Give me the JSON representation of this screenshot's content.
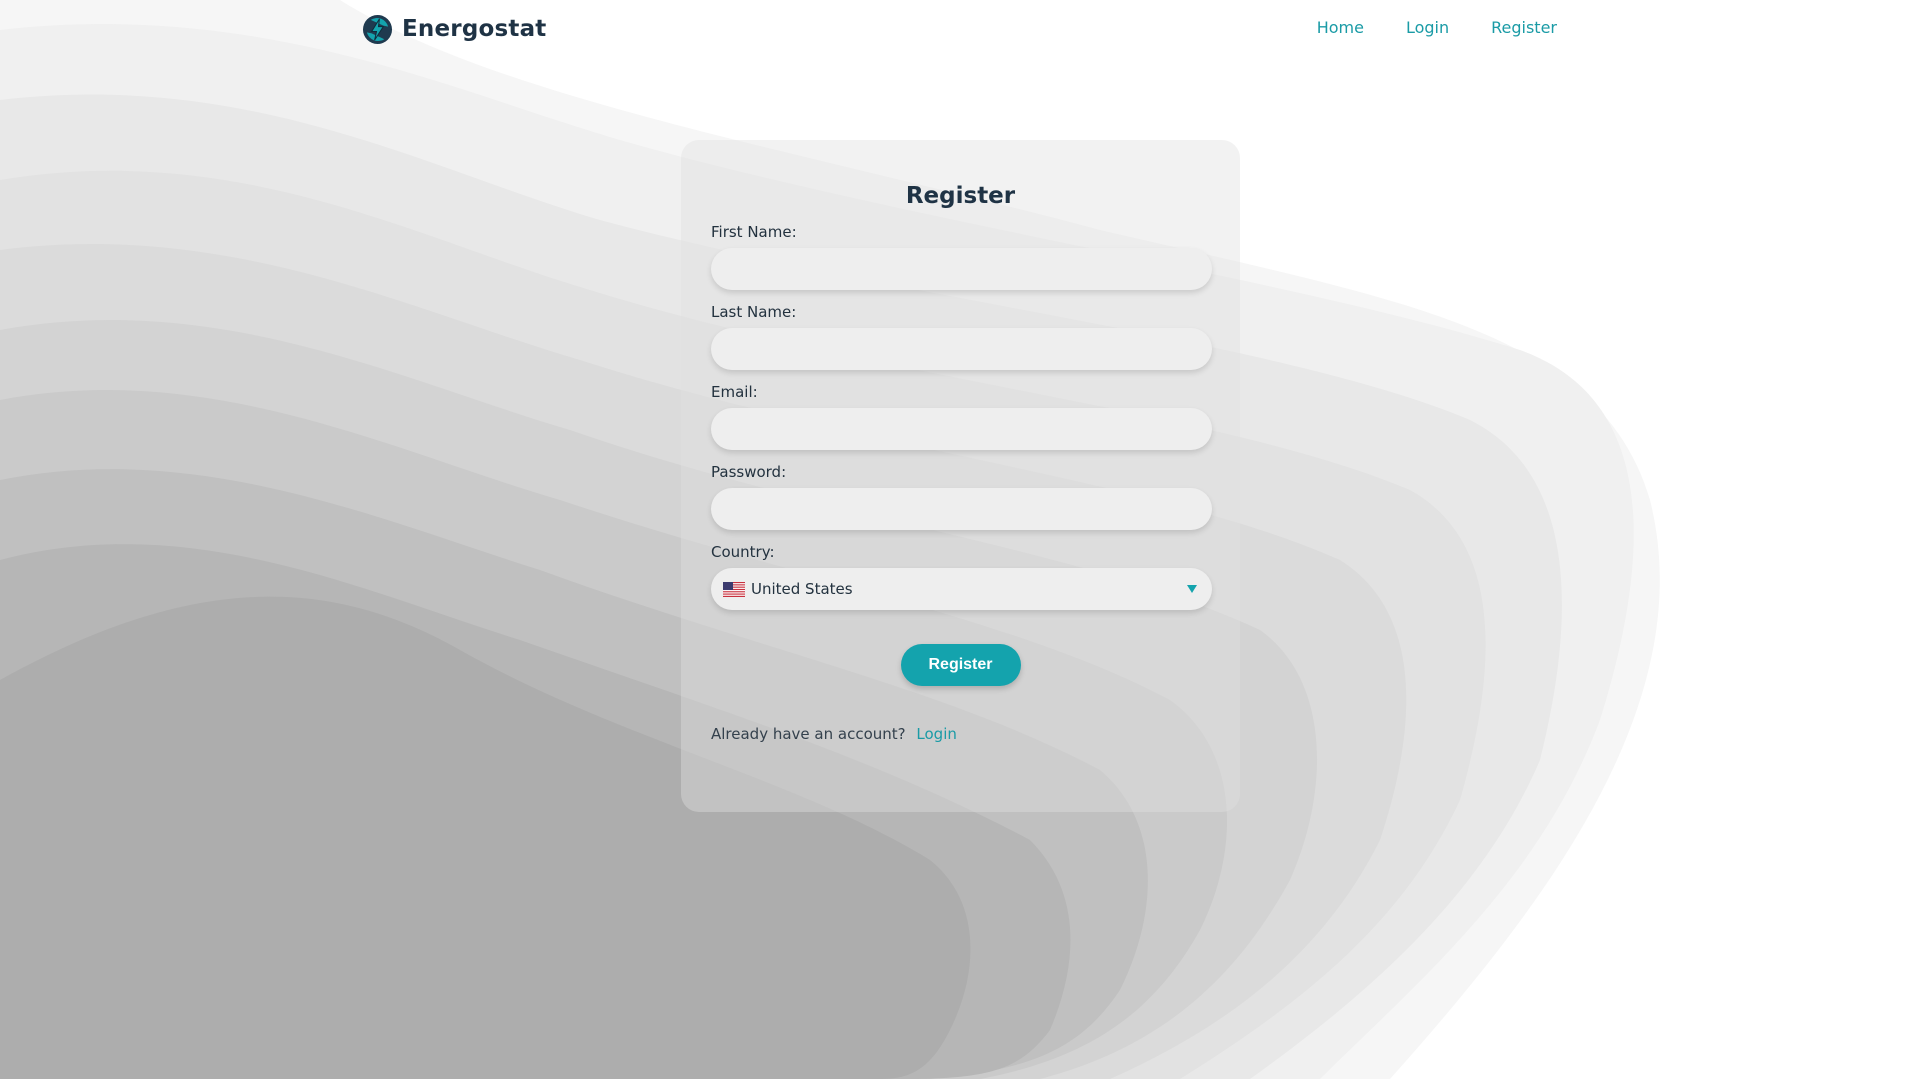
{
  "header": {
    "brand_name": "Energostat",
    "nav": [
      {
        "label": "Home"
      },
      {
        "label": "Login"
      },
      {
        "label": "Register"
      }
    ]
  },
  "form": {
    "title": "Register",
    "fields": {
      "first_name": {
        "label": "First Name:",
        "value": ""
      },
      "last_name": {
        "label": "Last Name:",
        "value": ""
      },
      "email": {
        "label": "Email:",
        "value": ""
      },
      "password": {
        "label": "Password:",
        "value": ""
      },
      "country": {
        "label": "Country:",
        "selected": "United States",
        "flag": "us-flag-icon"
      }
    },
    "submit_label": "Register",
    "footer_text": "Already have an account?",
    "footer_link": "Login"
  },
  "colors": {
    "accent": "#14a3ad",
    "link": "#1a9ba6",
    "heading": "#1f3345",
    "background": "#ffffff"
  },
  "icons": {
    "brand": "lightning-bolt-icon",
    "select": "chevron-down-icon"
  }
}
